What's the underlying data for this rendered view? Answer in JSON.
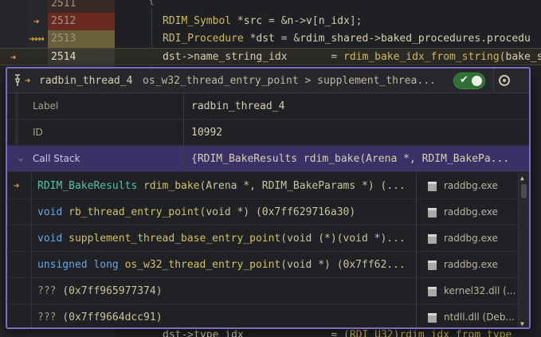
{
  "editor": {
    "lines": [
      {
        "num": "2511",
        "code": ""
      },
      {
        "num": "2512",
        "code": "RDIM_Symbol *src = &n->v[n_idx];"
      },
      {
        "num": "2513",
        "code": "RDI_Procedure *dst = &rdim_shared->baked_procedures.procedu"
      },
      {
        "num": "2514",
        "code": "dst->name_string_idx       = rdim_bake_idx_from_string(bake_s"
      },
      {
        "num": "",
        "code": "dst->type_idx              = (RDI_U32)rdim_idx_from_type"
      }
    ]
  },
  "popup": {
    "header": {
      "thread_name": "radbin_thread_4",
      "path": "os_w32_thread_entry_point > supplement_threa..."
    },
    "fields": [
      {
        "label": "Label",
        "value": "radbin_thread_4"
      },
      {
        "label": "ID",
        "value": "10992"
      },
      {
        "label": "Call Stack",
        "value": "{RDIM_BakeResults rdim_bake(Arena *, RDIM_BakePa..."
      }
    ],
    "stack": [
      {
        "prefix": "",
        "fn": "RDIM_BakeResults",
        "name": "rdim_bake",
        "args": "(Arena *, RDIM_BakeParams *) (...",
        "module": "raddbg.exe"
      },
      {
        "prefix": "void",
        "fn": "",
        "name": "rb_thread_entry_point",
        "args": "(void *) (0x7ff629716a30)",
        "module": "raddbg.exe"
      },
      {
        "prefix": "void",
        "fn": "",
        "name": "supplement_thread_base_entry_point",
        "args": "(void (*)(void *)...",
        "module": "raddbg.exe"
      },
      {
        "prefix": "unsigned long",
        "fn": "",
        "name": "os_w32_thread_entry_point",
        "args": "(void *) (0x7ff62...",
        "module": "raddbg.exe"
      },
      {
        "prefix": "",
        "fn": "",
        "name": "???",
        "args": "(0x7ff965977374)",
        "module": "kernel32.dll (..."
      },
      {
        "prefix": "",
        "fn": "",
        "name": "???",
        "args": "(0x7ff9664dcc91)",
        "module": "ntdll.dll (Deb..."
      }
    ]
  },
  "colors": {
    "accent": "#7d6bc4",
    "selection": "#3a3266",
    "arrow": "#e0a23b",
    "toggle_on": "#2f6f33"
  },
  "icons": [
    "pin-icon",
    "current-frame-arrow-icon",
    "toggle-check-icon",
    "settings-icon",
    "chevron-down-icon",
    "module-icon"
  ]
}
